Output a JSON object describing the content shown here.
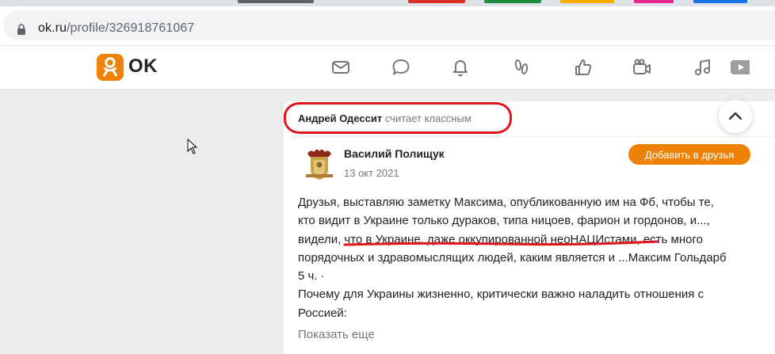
{
  "browser": {
    "url_host": "ok.ru",
    "url_path": "/profile/326918761067",
    "tab_colors": [
      "#5f6368",
      "#d93025",
      "#1e8e3e",
      "#f9ab00",
      "#e52592",
      "#1a73e8"
    ]
  },
  "site": {
    "logo_text": "OK",
    "brand_color": "#ee8208",
    "nav_icons": [
      "mail-icon",
      "chat-icon",
      "bell-icon",
      "guests-icon",
      "like-icon",
      "video-call-icon",
      "music-icon",
      "video-icon"
    ]
  },
  "feed": {
    "liker_name": "Андрей Одессит",
    "liker_action": "считает классным",
    "post": {
      "author": "Василий Полищук",
      "date": "13 окт 2021",
      "add_friend_label": "Добавить в друзья",
      "lines": [
        "Друзья, выставляю заметку Максима, опубликованную им на Фб, чтобы те,",
        "кто видит в Украине только дураков, типа ницоев, фарион и гордонов, и...,",
        "видели, что в Украине, даже оккупированной неоНАЦИстами, есть много",
        "порядочных и здравомыслящих людей, каким является и ...Максим Гольдарб",
        "5 ч.  ·",
        "Почему для Украины жизненно, критически важно наладить отношения с",
        "Россией:"
      ],
      "show_more": "Показать еще"
    }
  },
  "annotation_color": "#e0141d"
}
